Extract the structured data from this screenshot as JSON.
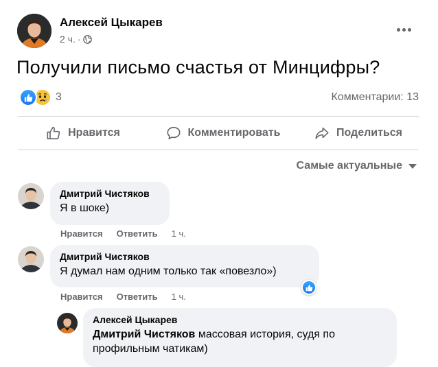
{
  "post": {
    "author": "Алексей Цыкарев",
    "time": "2 ч.",
    "separator": "·",
    "privacy_icon": "globe-icon",
    "text": "Получили письмо счастья от Минцифры?",
    "reactions": {
      "icons": [
        "like-icon",
        "sad-icon"
      ],
      "count": "3"
    },
    "comments_count": "Комментарии: 13"
  },
  "actions": {
    "like": "Нравится",
    "comment": "Комментировать",
    "share": "Поделиться"
  },
  "sort_label": "Самые актуальные",
  "comments": [
    {
      "author": "Дмитрий Чистяков",
      "text": "Я в шоке)",
      "like": "Нравится",
      "reply": "Ответить",
      "time": "1 ч."
    },
    {
      "author": "Дмитрий Чистяков",
      "text": "Я думал нам одним только так «повезло»)",
      "like": "Нравится",
      "reply": "Ответить",
      "time": "1 ч.",
      "reaction_icon": "like-icon"
    }
  ],
  "reply": {
    "author": "Алексей Цыкарев",
    "mention": "Дмитрий Чистяков",
    "text": "массовая история, судя по профильным чатикам)"
  },
  "colors": {
    "accent": "#1877f2",
    "secondary_text": "#65676b",
    "bubble": "#f0f2f5",
    "divider": "#ced0d4"
  }
}
